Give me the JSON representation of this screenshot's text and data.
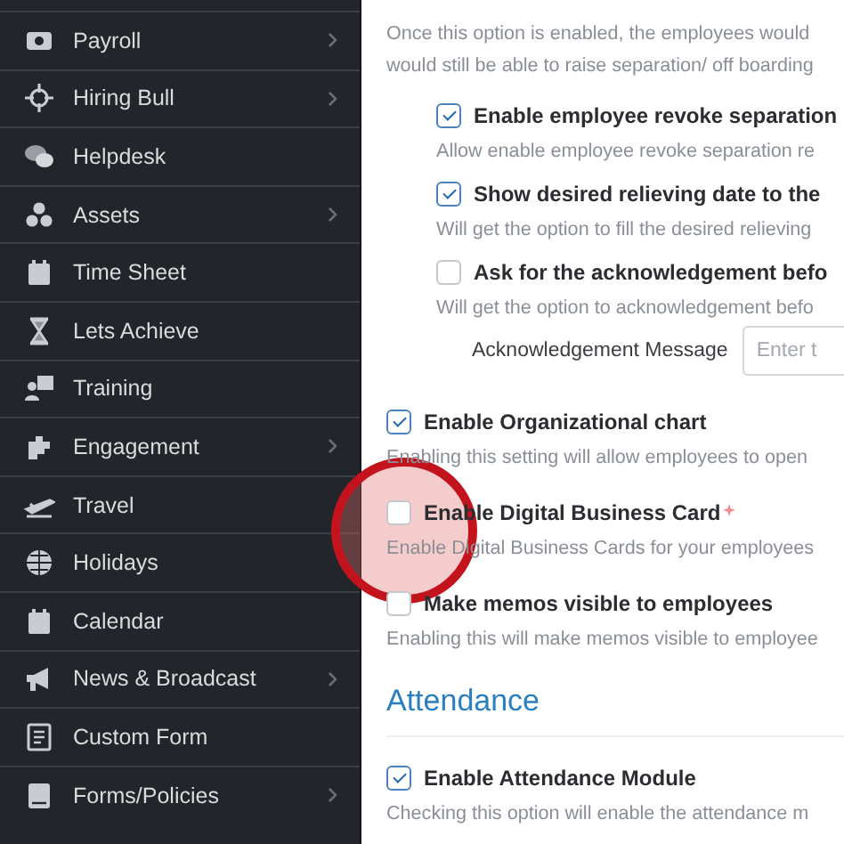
{
  "sidebar": {
    "items": [
      {
        "label": "Payroll",
        "expandable": true
      },
      {
        "label": "Hiring Bull",
        "expandable": true
      },
      {
        "label": "Helpdesk",
        "expandable": false
      },
      {
        "label": "Assets",
        "expandable": true
      },
      {
        "label": "Time Sheet",
        "expandable": false
      },
      {
        "label": "Lets Achieve",
        "expandable": false
      },
      {
        "label": "Training",
        "expandable": false
      },
      {
        "label": "Engagement",
        "expandable": true
      },
      {
        "label": "Travel",
        "expandable": false
      },
      {
        "label": "Holidays",
        "expandable": false
      },
      {
        "label": "Calendar",
        "expandable": false
      },
      {
        "label": "News & Broadcast",
        "expandable": true
      },
      {
        "label": "Custom Form",
        "expandable": false
      },
      {
        "label": "Forms/Policies",
        "expandable": true
      }
    ]
  },
  "settings": [
    {
      "kind": "note",
      "description": [
        "Once this option is enabled, the employees would",
        "would still be able to raise separation/ off boarding"
      ],
      "children": [
        {
          "kind": "option",
          "title": "Enable employee revoke separation",
          "checked": true,
          "description": [
            "Allow enable employee revoke separation re"
          ]
        },
        {
          "kind": "option",
          "title": "Show desired relieving date to the",
          "checked": true,
          "description": [
            "Will get the option to fill the desired relieving"
          ]
        },
        {
          "kind": "option",
          "title": "Ask for the acknowledgement befo",
          "checked": false,
          "description": [
            "Will get the option to acknowledgement befo"
          ]
        },
        {
          "kind": "input",
          "label": "Acknowledgement Message",
          "placeholder": "Enter t"
        }
      ]
    },
    {
      "kind": "option",
      "title": "Enable Organizational chart",
      "checked": true,
      "description": [
        "Enabling this setting will allow employees to open"
      ]
    },
    {
      "kind": "option",
      "title": "Enable Digital Business Card",
      "checked": false,
      "new_badge": true,
      "description": [
        "Enable Digital Business Cards for your employees"
      ]
    },
    {
      "kind": "option",
      "title": "Make memos visible to employees",
      "checked": false,
      "description": [
        "Enabling this will make memos visible to employee"
      ]
    },
    {
      "kind": "section",
      "title": "Attendance"
    },
    {
      "kind": "option",
      "title": "Enable Attendance Module",
      "checked": true,
      "description": [
        "Checking this option will enable the attendance m"
      ]
    }
  ]
}
